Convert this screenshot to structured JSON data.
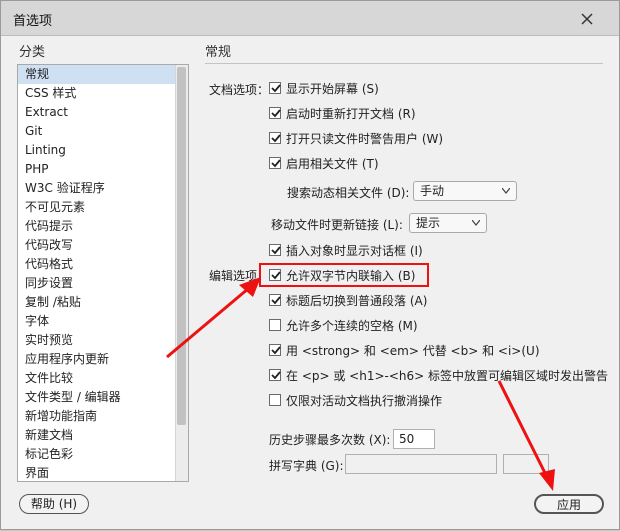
{
  "window": {
    "title": "首选项"
  },
  "sidebar": {
    "label": "分类",
    "items": [
      {
        "label": "常规",
        "selected": true
      },
      {
        "label": "CSS 样式"
      },
      {
        "label": "Extract"
      },
      {
        "label": "Git"
      },
      {
        "label": "Linting"
      },
      {
        "label": "PHP"
      },
      {
        "label": "W3C 验证程序"
      },
      {
        "label": "不可见元素"
      },
      {
        "label": "代码提示"
      },
      {
        "label": "代码改写"
      },
      {
        "label": "代码格式"
      },
      {
        "label": "同步设置"
      },
      {
        "label": "复制 /粘贴"
      },
      {
        "label": "字体"
      },
      {
        "label": "实时预览"
      },
      {
        "label": "应用程序内更新"
      },
      {
        "label": "文件比较"
      },
      {
        "label": "文件类型 / 编辑器"
      },
      {
        "label": "新增功能指南"
      },
      {
        "label": "新建文档"
      },
      {
        "label": "标记色彩"
      },
      {
        "label": "界面"
      }
    ]
  },
  "main": {
    "section_title": "常规",
    "doc_options_label": "文档选项：",
    "edit_options_label": "编辑选项：",
    "doc_options": [
      {
        "label": "显示开始屏幕 (S)",
        "checked": true
      },
      {
        "label": "启动时重新打开文档 (R)",
        "checked": true
      },
      {
        "label": "打开只读文件时警告用户 (W)",
        "checked": true
      },
      {
        "label": "启用相关文件 (T)",
        "checked": true
      }
    ],
    "search_related_label": "搜索动态相关文件 (D):",
    "search_related_value": "手动",
    "update_links_label": "移动文件时更新链接 (L):",
    "update_links_value": "提示",
    "insert_dialog": {
      "label": "插入对象时显示对话框 (I)",
      "checked": true
    },
    "edit_options": [
      {
        "label": "允许双字节内联输入 (B)",
        "checked": true
      },
      {
        "label": "标题后切换到普通段落 (A)",
        "checked": true
      },
      {
        "label": "允许多个连续的空格 (M)",
        "checked": false
      },
      {
        "label": "用 <strong> 和 <em> 代替 <b> 和 <i>(U)",
        "checked": true
      },
      {
        "label": "在 <p> 或 <h1>-<h6> 标签中放置可编辑区域时发出警告",
        "checked": true
      },
      {
        "label": "仅限对活动文档执行撤消操作",
        "checked": false
      }
    ],
    "history_label": "历史步骤最多次数 (X):",
    "history_value": "50",
    "spell_label": "拼写字典 (G):",
    "spell_value": ""
  },
  "footer": {
    "help_label": "帮助 (H)",
    "apply_label": "应用"
  },
  "colors": {
    "highlight": "#ee1111",
    "selected_bg": "#cfe0f3"
  }
}
